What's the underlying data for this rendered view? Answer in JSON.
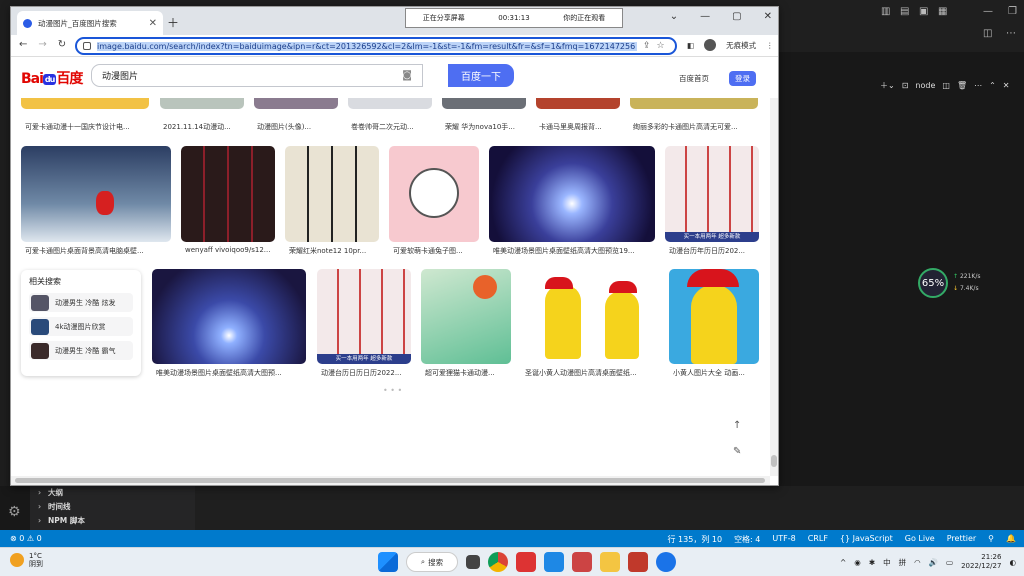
{
  "browser": {
    "tab_title": "动漫图片_百度图片搜索",
    "url": "image.baidu.com/search/index?tn=baiduimage&ipn=r&ct=201326592&cl=2&lm=-1&st=-1&fm=result&fr=&sf=1&fmq=1672147256",
    "profile_label": "无痕模式",
    "recording": {
      "label": "正在分享屏幕",
      "time": "00:31:13",
      "status": "你的正在观看"
    }
  },
  "baidu": {
    "logo_text": "Bai",
    "logo_paw": "du",
    "logo_cn": "百度",
    "search_value": "动漫图片",
    "search_button": "百度一下",
    "home_link": "百度首页",
    "login_button": "登录"
  },
  "results": {
    "row1_captions": [
      "可爱卡通动漫十一国庆节设计电...",
      "2021.11.14动漫动...",
      "动漫图片(头像)...",
      "卷卷帅哥二次元动...",
      "荣耀 华为nova10手...",
      "卡通马里奥周报背...",
      "绚丽多彩的卡通图片高清无可爱..."
    ],
    "row2_captions": [
      "可爱卡通图片桌面背景高清电脑桌壁...",
      "wenyaff vivoiqoo9/s12...",
      "荣耀红米note12 10pr...",
      "可爱软萌卡通兔子图...",
      "唯美动漫场景图片桌面壁纸高清大图预览19...",
      "动漫台历年历日历202..."
    ],
    "row3_captions": [
      "唯美动漫场景图片桌面壁纸高清大图预...",
      "动漫台历日历日历2022...",
      "超可爱狸猫卡通动漫...",
      "圣诞小黄人动漫图片高清桌面壁纸...",
      "小黄人图片大全 动画..."
    ],
    "banner_text": "买一本用两年 超多新款",
    "related": {
      "heading": "相关搜索",
      "items": [
        "动漫男生 冷酷 炫发",
        "4k动漫图片欣赏",
        "动漫男生 冷酷 霸气"
      ]
    },
    "dots": "• • •"
  },
  "vscode": {
    "node_label": "node",
    "network": {
      "percent": "65%",
      "up": "221K/s",
      "down": "7.4K/s"
    },
    "outline": [
      "大纲",
      "时间线",
      "NPM 脚本"
    ],
    "status_left": "⊗ 0 ⚠ 0",
    "status_items": [
      "行 135，列 10",
      "空格: 4",
      "UTF-8",
      "CRLF",
      "{} JavaScript",
      "Go Live",
      "Prettier"
    ]
  },
  "taskbar": {
    "weather_temp": "1°C",
    "weather_desc": "阴到",
    "search_label": "搜索",
    "ime_lang": "中",
    "ime_mode": "拼",
    "time": "21:26",
    "date": "2022/12/27"
  }
}
